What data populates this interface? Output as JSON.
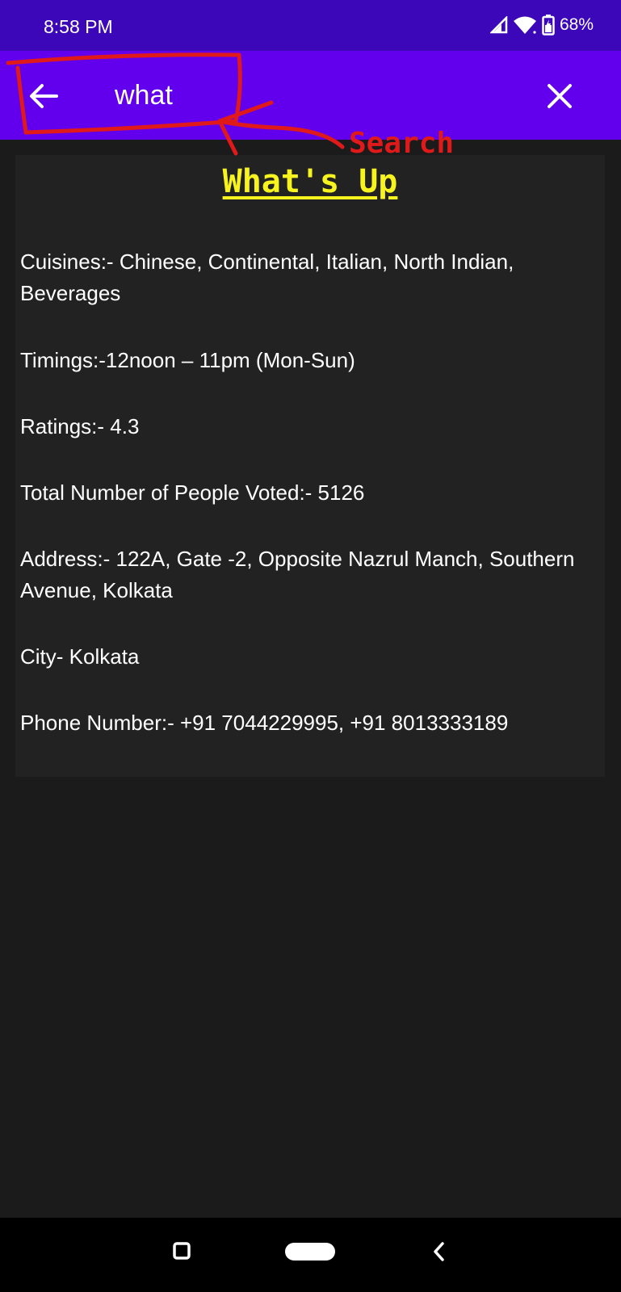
{
  "status": {
    "time": "8:58 PM",
    "battery": "68%"
  },
  "search": {
    "query": "what"
  },
  "card": {
    "title": "What's Up",
    "cuisines": "Cuisines:- Chinese, Continental, Italian, North Indian, Beverages",
    "timings": "Timings:-12noon – 11pm (Mon-Sun)",
    "ratings": "Ratings:- 4.3",
    "votes": "Total Number of People Voted:- 5126",
    "address": "Address:- 122A, Gate -2, Opposite Nazrul Manch, Southern Avenue, Kolkata",
    "city": "City- Kolkata",
    "phone": "Phone Number:- +91 7044229995, +91 8013333189"
  },
  "annotation": {
    "label": "Search",
    "color": "#e0191b"
  },
  "colors": {
    "status_bar": "#3c07b8",
    "app_bar": "#6200ee",
    "background": "#1b1b1b",
    "card": "#222222",
    "title": "#f6f31e"
  },
  "icons": {
    "back": "arrow-left-icon",
    "close": "close-icon",
    "signal": "signal-icon",
    "wifi": "wifi-icon",
    "battery": "battery-icon",
    "nav_recents": "square-icon",
    "nav_home": "pill-icon",
    "nav_back": "chevron-left-icon"
  }
}
